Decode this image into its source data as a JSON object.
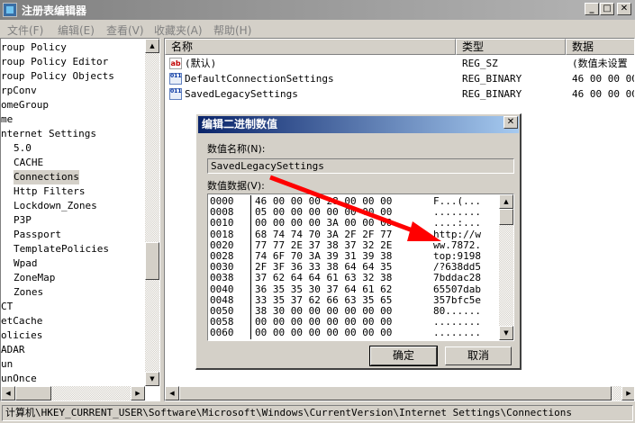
{
  "window": {
    "title": "注册表编辑器"
  },
  "menu": [
    "文件(F)",
    "编辑(E)",
    "查看(V)",
    "收藏夹(A)",
    "帮助(H)"
  ],
  "tree": {
    "items": [
      {
        "label": "roup Policy",
        "indent": false,
        "selected": false
      },
      {
        "label": "roup Policy Editor",
        "indent": false,
        "selected": false
      },
      {
        "label": "roup Policy Objects",
        "indent": false,
        "selected": false
      },
      {
        "label": "rpConv",
        "indent": false,
        "selected": false
      },
      {
        "label": "omeGroup",
        "indent": false,
        "selected": false
      },
      {
        "label": "me",
        "indent": false,
        "selected": false
      },
      {
        "label": "nternet Settings",
        "indent": false,
        "selected": false
      },
      {
        "label": "5.0",
        "indent": true,
        "selected": false
      },
      {
        "label": "CACHE",
        "indent": true,
        "selected": false
      },
      {
        "label": "Connections",
        "indent": true,
        "selected": true
      },
      {
        "label": "Http Filters",
        "indent": true,
        "selected": false
      },
      {
        "label": "Lockdown_Zones",
        "indent": true,
        "selected": false
      },
      {
        "label": "P3P",
        "indent": true,
        "selected": false
      },
      {
        "label": "Passport",
        "indent": true,
        "selected": false
      },
      {
        "label": "TemplatePolicies",
        "indent": true,
        "selected": false
      },
      {
        "label": "Wpad",
        "indent": true,
        "selected": false
      },
      {
        "label": "ZoneMap",
        "indent": true,
        "selected": false
      },
      {
        "label": "Zones",
        "indent": true,
        "selected": false
      },
      {
        "label": "CT",
        "indent": false,
        "selected": false
      },
      {
        "label": "etCache",
        "indent": false,
        "selected": false
      },
      {
        "label": "olicies",
        "indent": false,
        "selected": false
      },
      {
        "label": "ADAR",
        "indent": false,
        "selected": false
      },
      {
        "label": "un",
        "indent": false,
        "selected": false
      },
      {
        "label": "unOnce",
        "indent": false,
        "selected": false
      }
    ]
  },
  "list": {
    "headers": {
      "name": "名称",
      "type": "类型",
      "data": "数据"
    },
    "rows": [
      {
        "icon": "ab",
        "kind": "string-value-icon",
        "name": "(默认)",
        "type": "REG_SZ",
        "data": "(数值未设置"
      },
      {
        "icon": "011",
        "kind": "binary-value-icon",
        "name": "DefaultConnectionSettings",
        "type": "REG_BINARY",
        "data": "46 00 00 00"
      },
      {
        "icon": "011",
        "kind": "binary-value-icon",
        "name": "SavedLegacySettings",
        "type": "REG_BINARY",
        "data": "46 00 00 00"
      }
    ]
  },
  "status": "计算机\\HKEY_CURRENT_USER\\Software\\Microsoft\\Windows\\CurrentVersion\\Internet Settings\\Connections",
  "dialog": {
    "title": "编辑二进制数值",
    "name_label": "数值名称(N):",
    "name_value": "SavedLegacySettings",
    "data_label": "数值数据(V):",
    "hex_rows": [
      {
        "offset": "0000",
        "bytes": "46 00 00 00 28 00 00 00",
        "ascii": "F...(..."
      },
      {
        "offset": "0008",
        "bytes": "05 00 00 00 00 00 00 00",
        "ascii": "........"
      },
      {
        "offset": "0010",
        "bytes": "00 00 00 00 3A 00 00 00",
        "ascii": "....:..."
      },
      {
        "offset": "0018",
        "bytes": "68 74 74 70 3A 2F 2F 77",
        "ascii": "http://w"
      },
      {
        "offset": "0020",
        "bytes": "77 77 2E 37 38 37 32 2E",
        "ascii": "ww.7872."
      },
      {
        "offset": "0028",
        "bytes": "74 6F 70 3A 39 31 39 38",
        "ascii": "top:9198"
      },
      {
        "offset": "0030",
        "bytes": "2F 3F 36 33 38 64 64 35",
        "ascii": "/?638dd5"
      },
      {
        "offset": "0038",
        "bytes": "37 62 64 64 61 63 32 38",
        "ascii": "7bddac28"
      },
      {
        "offset": "0040",
        "bytes": "36 35 35 30 37 64 61 62",
        "ascii": "65507dab"
      },
      {
        "offset": "0048",
        "bytes": "33 35 37 62 66 63 35 65",
        "ascii": "357bfc5e"
      },
      {
        "offset": "0050",
        "bytes": "38 30 00 00 00 00 00 00",
        "ascii": "80......"
      },
      {
        "offset": "0058",
        "bytes": "00 00 00 00 00 00 00 00",
        "ascii": "........"
      },
      {
        "offset": "0060",
        "bytes": "00 00 00 00 00 00 00 00",
        "ascii": "........"
      }
    ],
    "ok_label": "确定",
    "cancel_label": "取消"
  },
  "colors": {
    "title_active": "#0a246a",
    "title_gradient_end": "#a6caf0",
    "annotation_arrow": "#ff0000"
  }
}
